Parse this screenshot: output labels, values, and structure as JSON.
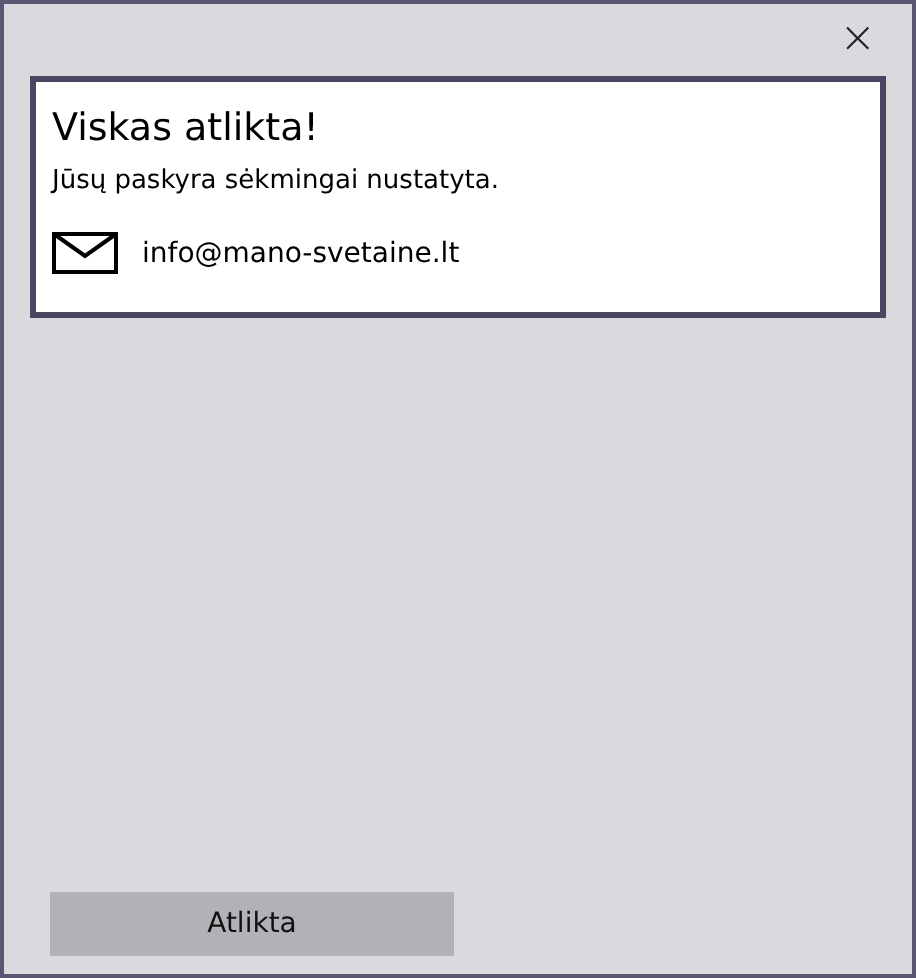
{
  "close_button": "×",
  "card": {
    "title": "Viskas atlikta!",
    "message": "Jūsų paskyra sėkmingai nustatyta.",
    "email": "info@mano-svetaine.lt"
  },
  "buttons": [
    "Atlikta"
  ]
}
